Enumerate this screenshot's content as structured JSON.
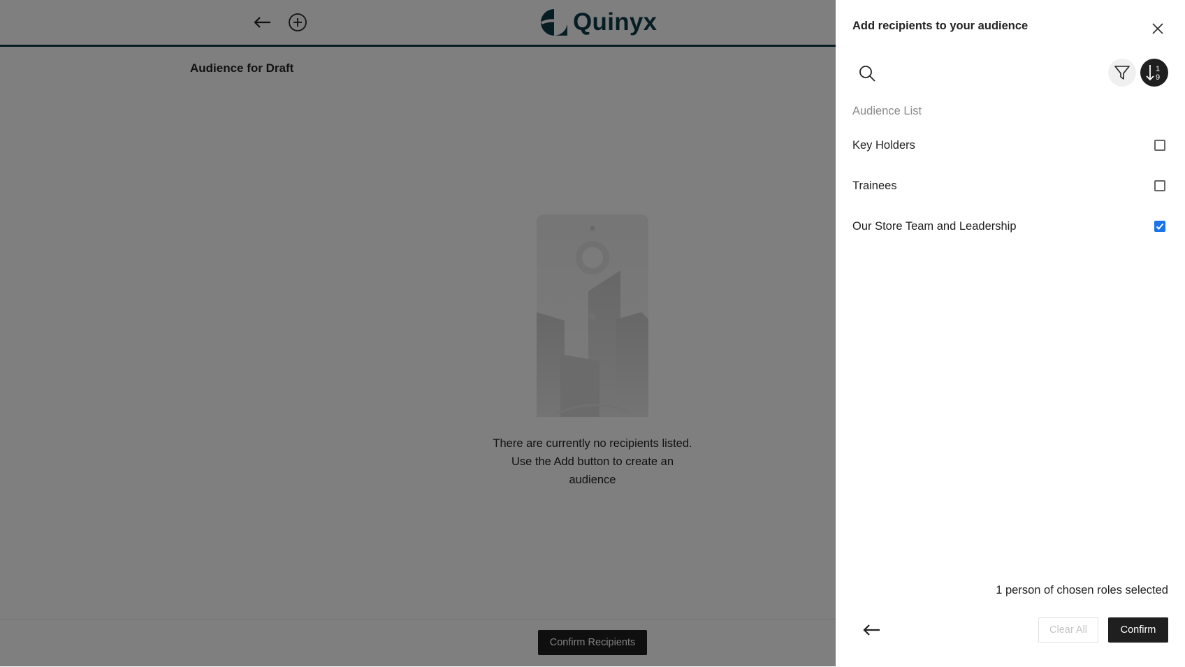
{
  "brand": {
    "name": "Quinyx",
    "color": "#0d3b47"
  },
  "main": {
    "page_title": "Audience for Draft",
    "empty_state_text": "There are currently no recipients listed. Use the Add button to create an audience",
    "confirm_recipients_label": "Confirm Recipients"
  },
  "drawer": {
    "title": "Add recipients to your audience",
    "list_heading": "Audience List",
    "items": [
      {
        "label": "Key Holders",
        "checked": false
      },
      {
        "label": "Trainees",
        "checked": false
      },
      {
        "label": "Our Store Team and Leadership",
        "checked": true
      }
    ],
    "selection_summary": "1 person of chosen roles selected",
    "clear_label": "Clear All",
    "confirm_label": "Confirm",
    "sort_icon_digits": [
      "1",
      "9"
    ]
  },
  "colors": {
    "accent_checked": "#1a73e8",
    "dark_button": "#1f1f1f"
  },
  "icons": [
    "back-arrow-icon",
    "add-circle-icon",
    "close-icon",
    "search-icon",
    "filter-icon",
    "sort-numeric-icon"
  ]
}
